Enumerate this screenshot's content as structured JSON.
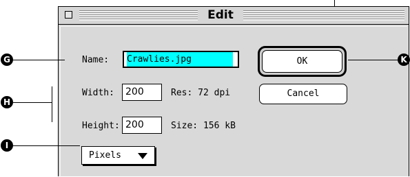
{
  "dialog": {
    "title": "Edit"
  },
  "fields": {
    "name_label": "Name:",
    "name_value": "Crawlies.jpg",
    "width_label": "Width:",
    "width_value": "200",
    "height_label": "Height:",
    "height_value": "200",
    "res_text": "Res:  72 dpi",
    "size_text": "Size: 156 kB"
  },
  "buttons": {
    "ok_label": "OK",
    "cancel_label": "Cancel"
  },
  "popup": {
    "selected": "Pixels"
  },
  "callouts": {
    "g": "G",
    "h": "H",
    "i": "I",
    "k": "K"
  },
  "colors": {
    "selection_highlight": "#00ffff",
    "dialog_background": "#d9d9d9"
  },
  "icons": {
    "popup_arrow": "triangle-down-icon",
    "close_box": "close-box-icon"
  }
}
